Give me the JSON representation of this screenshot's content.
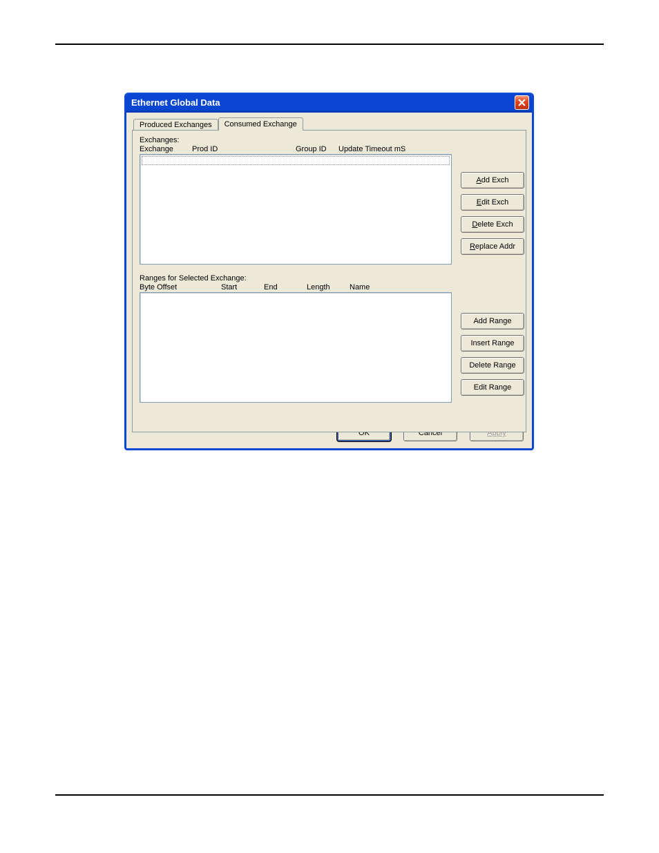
{
  "dialog": {
    "title": "Ethernet Global Data",
    "tabs": {
      "produced": "Produced Exchanges",
      "consumed": "Consumed Exchange"
    },
    "exchanges": {
      "label": "Exchanges:",
      "cols": {
        "exchange": "Exchange",
        "prod_id": "Prod ID",
        "group_id": "Group ID",
        "update_timeout": "Update Timeout mS"
      }
    },
    "ranges": {
      "label": "Ranges for Selected Exchange:",
      "cols": {
        "byte_offset": "Byte Offset",
        "start": "Start",
        "end": "End",
        "length": "Length",
        "name": "Name"
      }
    },
    "buttons": {
      "add_exch": "Add Exch",
      "edit_exch": "Edit Exch",
      "delete_exch": "Delete Exch",
      "replace_addr": "Replace Addr",
      "add_range": "Add Range",
      "insert_range": "Insert Range",
      "delete_range": "Delete Range",
      "edit_range": "Edit Range",
      "ok": "OK",
      "cancel": "Cancel",
      "apply": "Apply"
    }
  }
}
